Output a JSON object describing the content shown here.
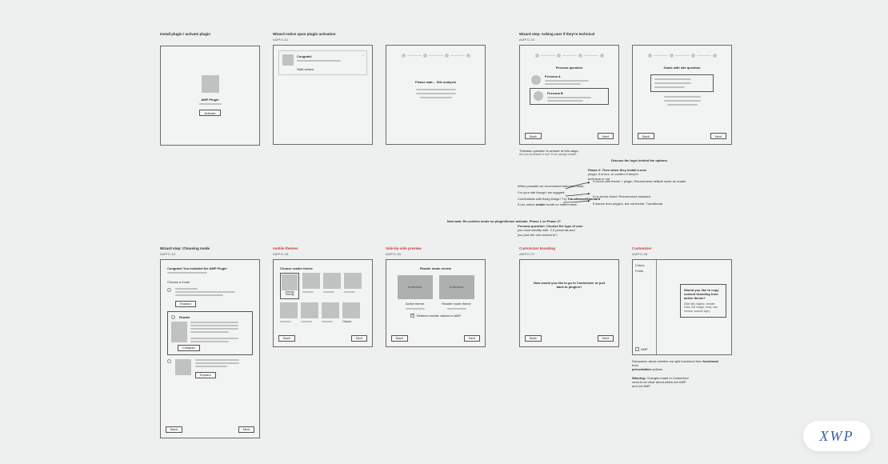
{
  "row1": {
    "c1": {
      "title": "Install plugin / activate plugin",
      "label": "AMP Plugin",
      "btn": "Activate"
    },
    "c2": {
      "title": "Wizard notice upon plugin activation",
      "sub": "AMPO-01",
      "congrats": "Congrats!",
      "start": "Start wizard",
      "wait": "Please wait… Site analysis"
    },
    "c3": {
      "title": "Wizard step: Asking user if they're technical",
      "sub": "AMPO-02",
      "qA": "Persona question",
      "pA": "Persona A",
      "pB": "Persona B",
      "qB": "Goals with site question",
      "back": "Back",
      "next": "Next",
      "note1a": "Thebasic question to answer at this stage:",
      "note1b": "Are you technical or not? If not, always reader.",
      "noteLogic": "Discuss the logic behind the options.",
      "phase2a": "Phase 2: Then when they install a new",
      "phase2b": "plugin, if errors, re-confirm if they're",
      "phase2c": "technical or not",
      "rec0": "When possible we recommend standard mode.",
      "rec1": "For your site though, we suggest:",
      "rec2a": "Comfortable with fixing things? Try",
      "rec2b": "Transitional/Standard",
      "rec3": "If not, select reader mode no matter what.",
      "arrowA": "0 errors with theme + plugin: Recommend default mode as reader",
      "arrowB": "If no errors found: Recommend standard",
      "arrowC": "If issues from plugins, but not theme: Transitional",
      "personaQa": "Persona question: Choose the type of user",
      "personaQb": "you most identify with. 2-3 personas and",
      "personaQc": "you pick the one closest to?"
    }
  },
  "midNote": "New task: Re-confirm mode on plugin/theme activate. Phase 1 vs Phase 2?",
  "row2": {
    "c1": {
      "title": "Wizard step: Choosing mode",
      "sub": "AMPO-04",
      "h": "Congrats! You installed the AMP Plugin",
      "choose": "Choose a mode",
      "reader": "Reader",
      "btnExpand": "Expand",
      "btnCollapse": "Collapse",
      "back": "Back",
      "next": "Next"
    },
    "c2": {
      "title": "mobile themes",
      "sub": "AMPO-05",
      "h": "Choose reader theme",
      "tlabel": "Twenty Twenty",
      "classic": "Classic",
      "back": "Back",
      "next": "Next"
    },
    "c3": {
      "title": "Side-by-side preview",
      "sub": "AMPO-06",
      "h": "Reader mode review",
      "shot": "Screenshot",
      "a": "Active theme",
      "b": "Reader mode theme",
      "chk": "Redirect mobile visitors to AMP",
      "back": "Back",
      "next": "Next"
    },
    "c4": {
      "title": "Customizer branding",
      "sub": "AMPO-07",
      "q": "Now would you like to go to Customizer or just back to plugins?",
      "back": "Back",
      "next": "Next"
    },
    "c5": {
      "title": "Customizer",
      "sub": "AMPO-08",
      "side1": "Colors",
      "side2": "Fonts",
      "ampTag": "AMP",
      "p1": "Would you like to copy content branding from active theme?",
      "p2": "(Site title, tagline, header color, BG image, fonts, nav menus, custom logo)",
      "d1a": "Discussion about whether we split functional from",
      "d1b": "presentation options",
      "w1a": "Warning: Changes made in Customizer",
      "w1b": "need to be clear about which are AMP",
      "w1c": "and not AMP"
    }
  },
  "logo": "XWP"
}
